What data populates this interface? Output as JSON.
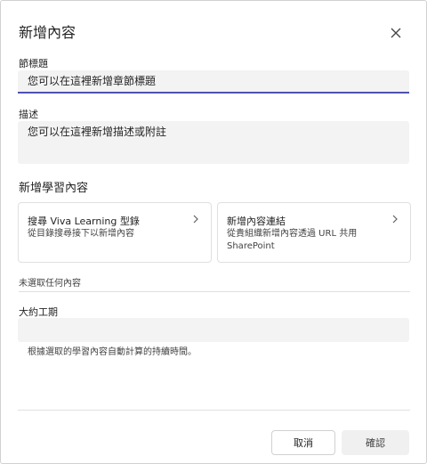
{
  "dialog": {
    "title": "新增內容"
  },
  "section_title_field": {
    "label": "節標題",
    "value": "您可以在這裡新增章節標題"
  },
  "description_field": {
    "label": "描述",
    "value": "您可以在這裡新增描述或附註"
  },
  "add_learning": {
    "title": "新增學習內容",
    "cards": [
      {
        "line1": "搜尋 Viva Learning 型錄",
        "line2": "從目錄搜尋接下以新增內容"
      },
      {
        "line1": "新增內容連結",
        "line2": "從貴組織新增內容透過 URL 共用 SharePoint"
      }
    ]
  },
  "status_note": "未選取任何內容",
  "duration_field": {
    "label": "大約工期",
    "help": "根據選取的學習內容自動計算的持續時間。"
  },
  "footer": {
    "cancel_label": "取消",
    "confirm_label": "確認"
  },
  "colors": {
    "accent": "#4f52b2",
    "input_bg": "#f3f3f3",
    "border": "#d1d1d1"
  }
}
